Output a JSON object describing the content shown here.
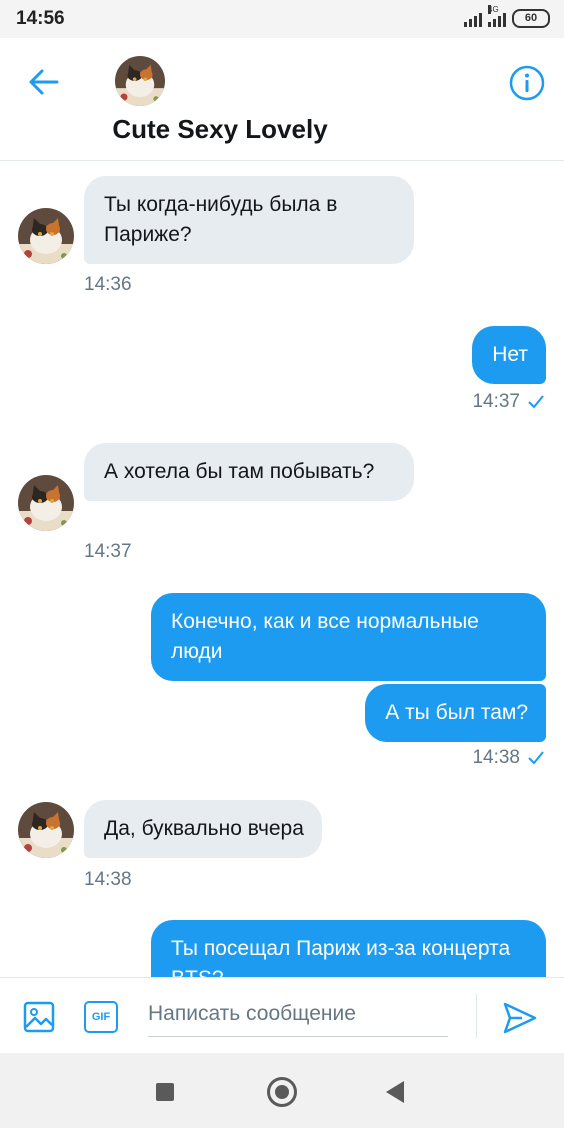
{
  "status_bar": {
    "time": "14:56",
    "network_type": "4G",
    "battery": "60"
  },
  "header": {
    "contact_name": "Cute Sexy Lovely",
    "back_icon": "arrow-left-icon",
    "info_icon": "info-circle-icon"
  },
  "messages": [
    {
      "direction": "in",
      "text": "Ты когда-нибудь была в Париже?",
      "time": "14:36"
    },
    {
      "direction": "out",
      "text": "Нет",
      "time": "14:37",
      "status": "sent-check"
    },
    {
      "direction": "in",
      "text": "А хотела бы там побывать?",
      "time": "14:37"
    },
    {
      "direction": "out",
      "text": "Конечно, как и все нормальные люди"
    },
    {
      "direction": "out",
      "text": "А ты был там?",
      "time": "14:38",
      "status": "sent-check"
    },
    {
      "direction": "in",
      "text": "Да, буквально вчера",
      "time": "14:38"
    },
    {
      "direction": "out",
      "text": "Ты посещал Париж из-за концерта BTS?"
    }
  ],
  "composer": {
    "placeholder": "Написать сообщение",
    "gif_label": "GIF",
    "media_icon": "image-icon",
    "send_icon": "send-icon"
  },
  "colors": {
    "accent": "#1d9bf0",
    "incoming_bubble": "#e6ecf0",
    "muted_text": "#657786"
  }
}
